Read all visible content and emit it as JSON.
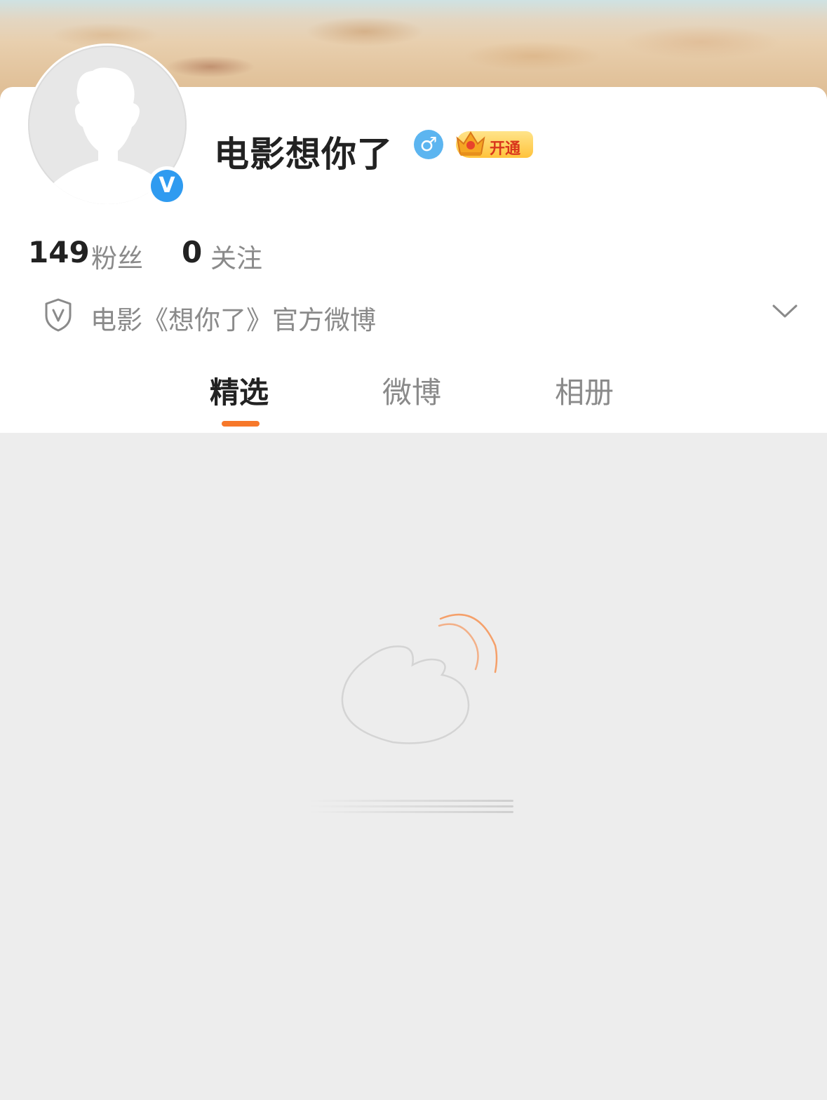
{
  "profile": {
    "name": "电影想你了",
    "gender_icon": "male-symbol-icon",
    "gender_symbol": "♂",
    "verified_badge": "V",
    "vip": {
      "label": "开通",
      "icon": "crown-icon"
    },
    "stats": {
      "followers_count": "149",
      "followers_label": "粉丝",
      "following_count": "0",
      "following_label": "关注"
    },
    "verification": {
      "icon": "shield-v-icon",
      "text": "电影《想你了》官方微博",
      "expand_icon": "chevron-down-icon"
    }
  },
  "tabs": [
    {
      "label": "精选",
      "active": true
    },
    {
      "label": "微博",
      "active": false
    },
    {
      "label": "相册",
      "active": false
    }
  ],
  "colors": {
    "accent": "#f7782a",
    "verified_blue": "#2f9bf0",
    "male_blue": "#5cb5f0",
    "background": "#ededed"
  },
  "loading": {
    "icon": "weibo-logo-icon"
  }
}
